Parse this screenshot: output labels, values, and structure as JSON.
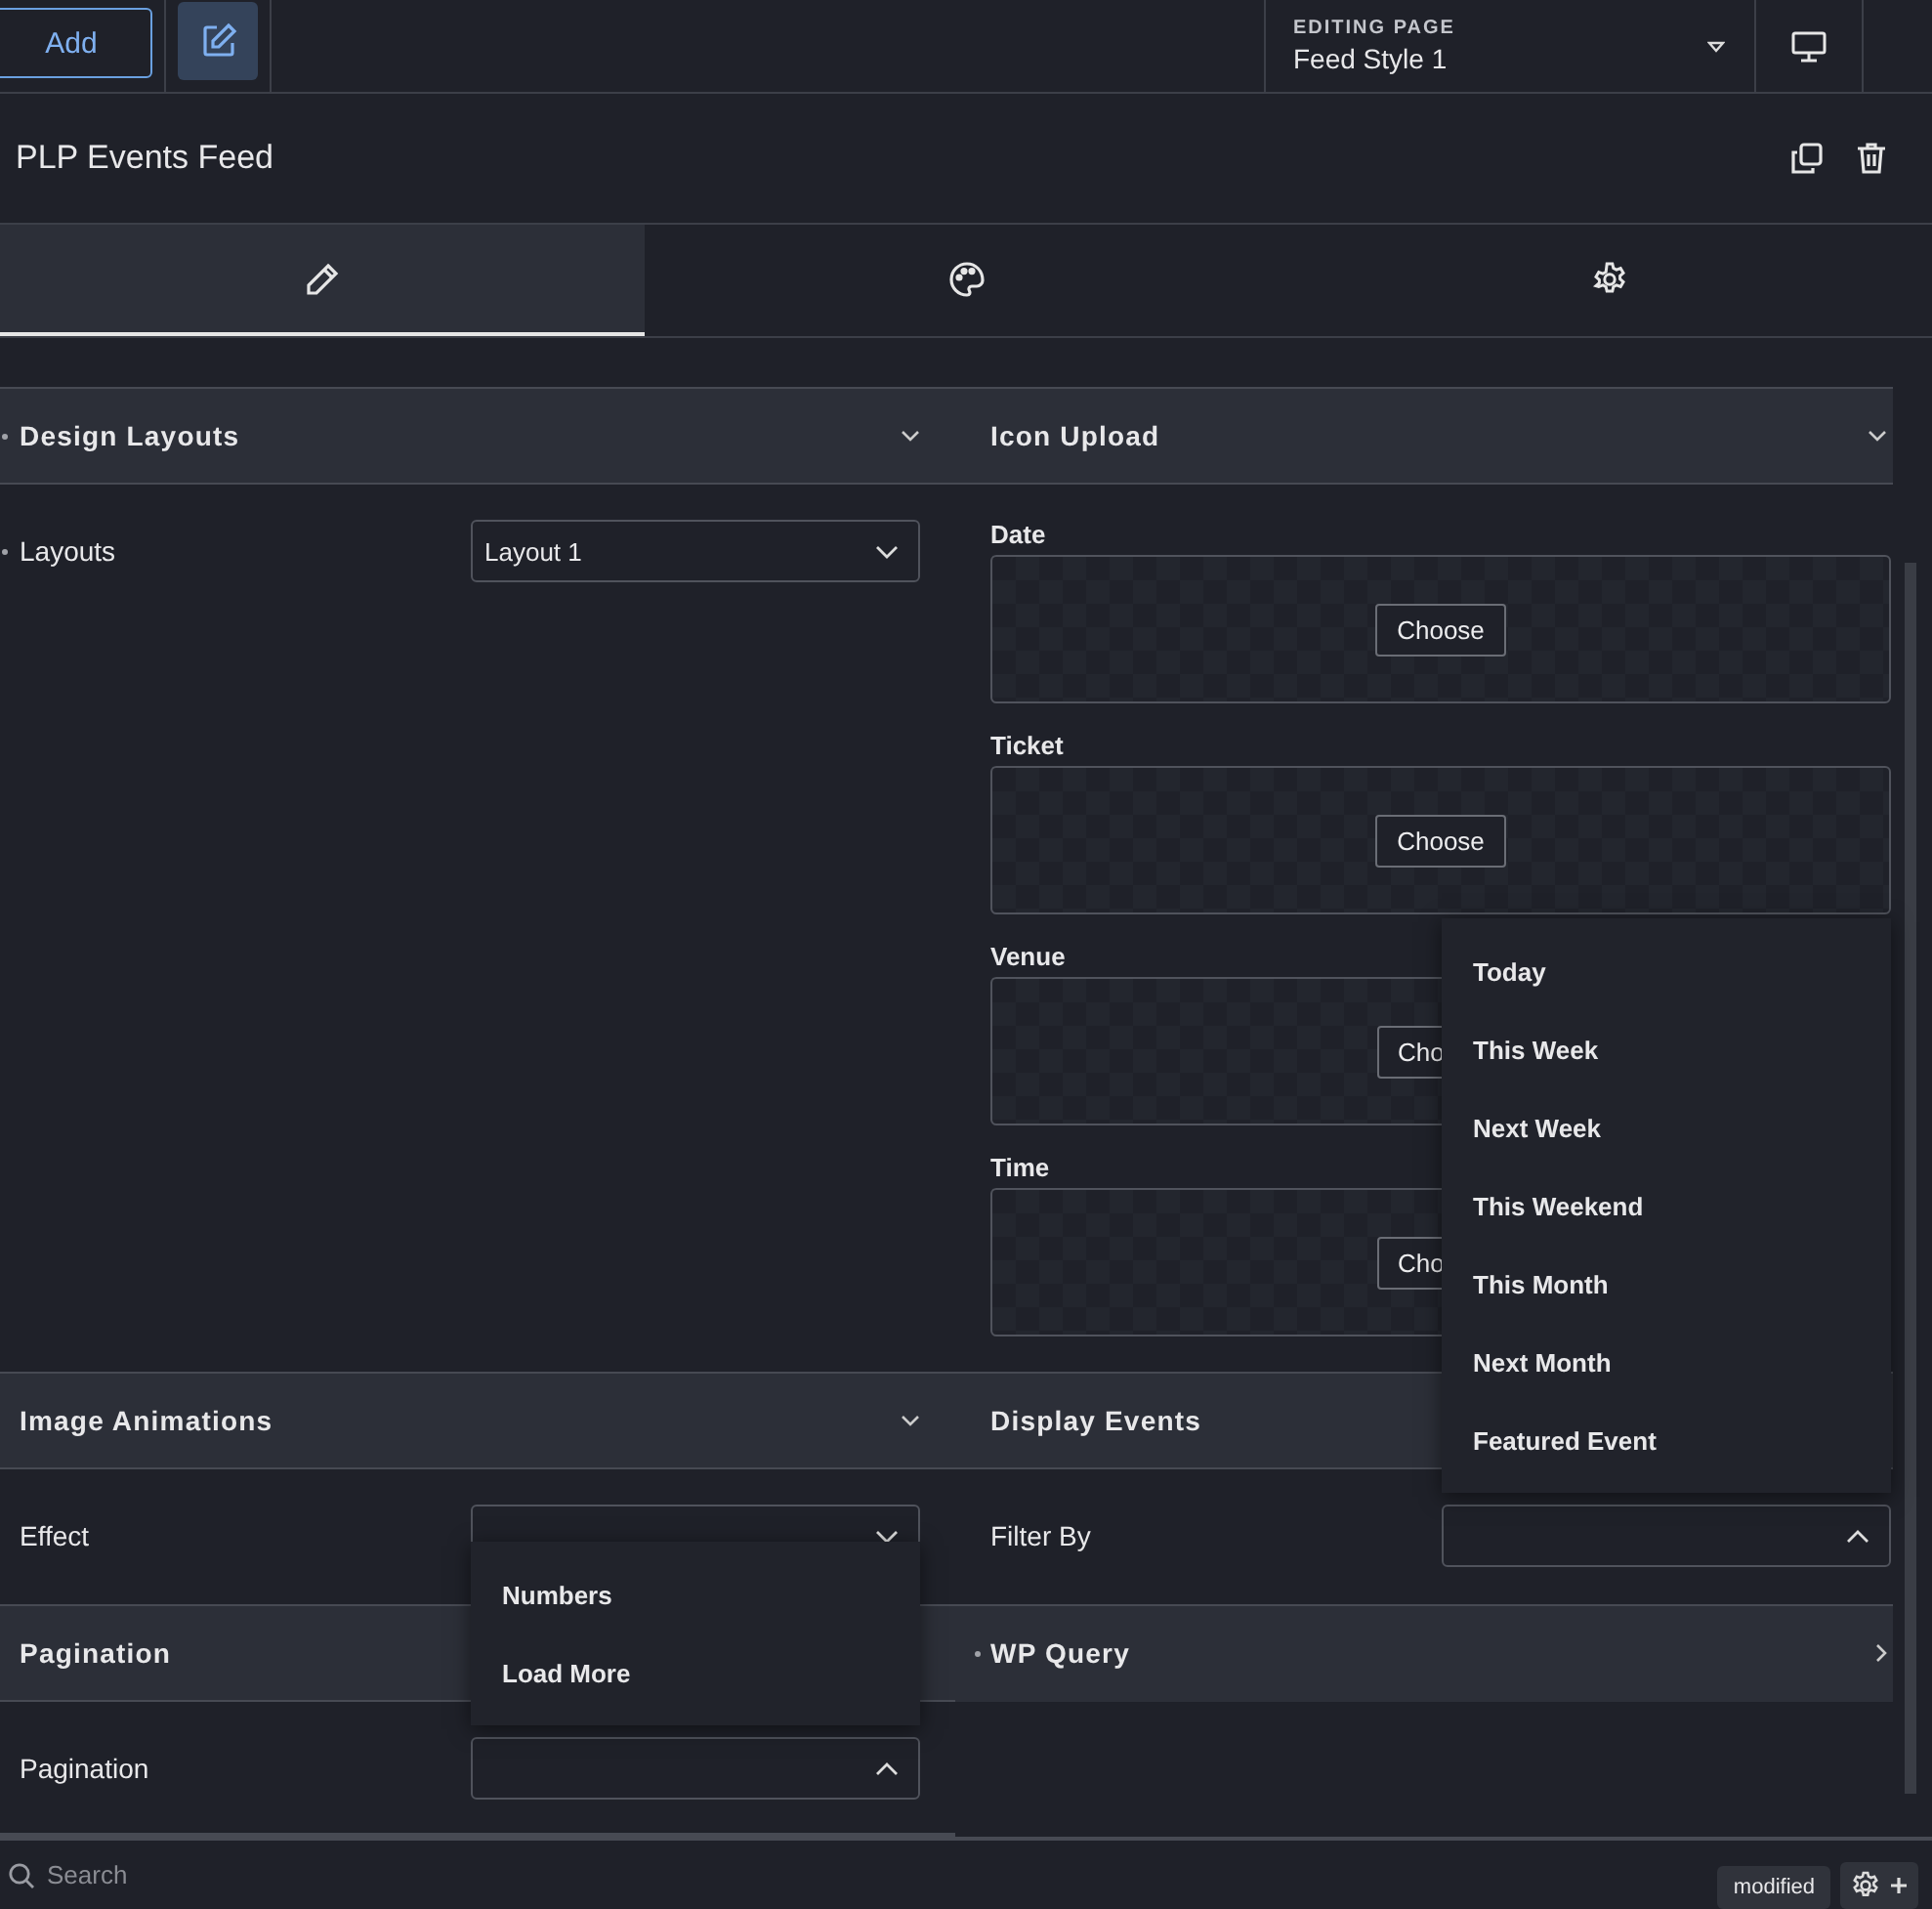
{
  "toolbar": {
    "add_button": "Add",
    "editing_label": "EDITING PAGE",
    "page_name": "Feed Style 1"
  },
  "widget_title": "PLP Events Feed",
  "tabs": [
    {
      "kind": "content",
      "selected": true
    },
    {
      "kind": "style",
      "selected": false
    },
    {
      "kind": "advanced",
      "selected": false
    }
  ],
  "rows": [
    {
      "left": {
        "title": "Design Layouts",
        "dot": true,
        "expanded": true,
        "fields": [
          {
            "kind": "select",
            "label": "Layouts",
            "dot": true,
            "value": "Layout 1",
            "open": false
          }
        ]
      },
      "right": {
        "title": "Icon Upload",
        "dot": false,
        "expanded": true,
        "fields": [
          {
            "kind": "upload",
            "label": "Date",
            "button": "Choose"
          },
          {
            "kind": "upload",
            "label": "Ticket",
            "button": "Choose"
          },
          {
            "kind": "upload",
            "label": "Venue",
            "button": "Cho"
          },
          {
            "kind": "upload",
            "label": "Time",
            "button": "Cho"
          }
        ]
      }
    },
    {
      "left": {
        "title": "Image Animations",
        "dot": false,
        "expanded": true,
        "fields": [
          {
            "kind": "select",
            "label": "Effect",
            "dot": false,
            "open": false
          }
        ]
      },
      "right": {
        "title": "Display Events",
        "dot": false,
        "expanded": true,
        "fields": [
          {
            "kind": "select",
            "label": "Filter By",
            "dot": false,
            "open": true,
            "options": [
              "Today",
              "This Week",
              "Next Week",
              "This Weekend",
              "This Month",
              "Next Month",
              "Featured Event"
            ]
          }
        ]
      }
    },
    {
      "left": {
        "title": "Pagination",
        "dot": false,
        "expanded": true,
        "fields": [
          {
            "kind": "select",
            "label": "Pagination",
            "dot": false,
            "open": true,
            "options": [
              "Numbers",
              "Load More"
            ]
          }
        ]
      },
      "right": {
        "title": "WP Query",
        "dot": true,
        "expanded": false
      }
    }
  ],
  "footer": {
    "search": {
      "placeholder": "Search"
    },
    "badge": "modified"
  }
}
